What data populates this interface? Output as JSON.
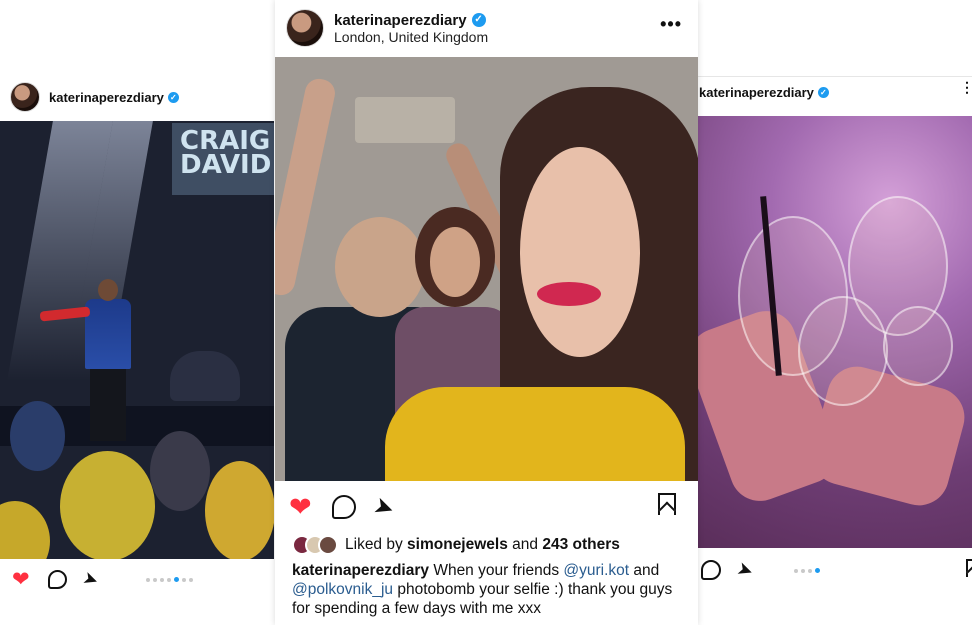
{
  "posts": {
    "left": {
      "username": "katerinaperezdiary",
      "verified_mark": "✓",
      "banner_line1": "CRAIG",
      "banner_line2": "DAVID",
      "drum_text": "CRAIG DAVID",
      "icons": [
        "heart-icon",
        "comment-icon",
        "share-icon"
      ],
      "carousel": {
        "count": 6,
        "active": 4
      }
    },
    "middle": {
      "username": "katerinaperezdiary",
      "verified_mark": "✓",
      "location": "London, United Kingdom",
      "more_label": "•••",
      "likes": {
        "prefix": "Liked by",
        "user": "simonejewels",
        "joiner": "and",
        "others": "243 others"
      },
      "caption": {
        "user": "katerinaperezdiary",
        "part1": "When your friends",
        "mention1": "@yuri.kot",
        "part2": "and",
        "mention2": "@polkovnik_ju",
        "part3": "photobomb your selfie :) thank you guys for spending a few days with me xxx"
      }
    },
    "right": {
      "username": "katerinaperezdiary",
      "verified_mark": "✓",
      "more_label": "⋮",
      "carousel": {
        "count": 4,
        "active": 4
      }
    }
  },
  "colors": {
    "like_red": "#ff3040",
    "verified_blue": "#1d9bf0",
    "mention_blue": "#2a5c8f",
    "carousel_active": "#1d9bf0"
  }
}
